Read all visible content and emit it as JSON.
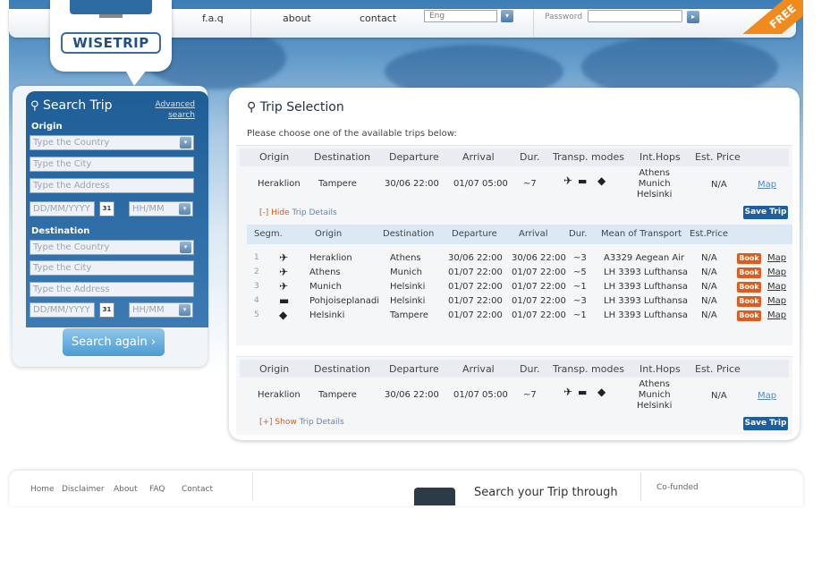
{
  "header": {
    "nav": [
      "f.a.q",
      "about",
      "contact"
    ],
    "language_value": "Eng",
    "password_label": "Password",
    "ribbon_text": "FREE",
    "logo_text": "WISETRIP"
  },
  "search": {
    "title": "Search Trip",
    "advanced_link": "Advanced search",
    "origin_label": "Origin",
    "destination_label": "Destination",
    "country_placeholder": "Type the Country",
    "city_placeholder": "Type the City",
    "address_placeholder": "Type the Address",
    "date_placeholder": "DD/MM/YYYY",
    "time_placeholder": "HH/MM",
    "calendar_day": "31",
    "search_again_label": "Search again ›"
  },
  "trips": {
    "title": "Trip Selection",
    "subtitle": "Please choose one of the available trips below:",
    "columns": [
      "Origin",
      "Destination",
      "Departure",
      "Arrival",
      "Dur.",
      "Transp. modes",
      "Int.Hops",
      "Est. Price"
    ],
    "list": [
      {
        "origin": "Heraklion",
        "destination": "Tampere",
        "departure": "30/06 22:00",
        "arrival": "01/07  05:00",
        "duration": "~7",
        "hops": [
          "Athens",
          "Munich",
          "Helsinki"
        ],
        "price": "N/A",
        "map": "Map",
        "save": "Save Trip",
        "toggle_action": "[-] Hide",
        "toggle_rest": "Trip Details"
      },
      {
        "origin": "Heraklion",
        "destination": "Tampere",
        "departure": "30/06 22:00",
        "arrival": "01/07  05:00",
        "duration": "~7",
        "hops": [
          "Athens",
          "Munich",
          "Helsinki"
        ],
        "price": "N/A",
        "map": "Map",
        "save": "Save Trip",
        "toggle_action": "[+] Show",
        "toggle_rest": "Trip Details"
      }
    ],
    "segment_columns": [
      "Segm.",
      "Origin",
      "Destination",
      "Departure",
      "Arrival",
      "Dur.",
      "Mean of Transport",
      "Est.Price"
    ],
    "segments": [
      {
        "n": "1",
        "icon": "plane",
        "origin": "Heraklion",
        "destination": "Athens",
        "departure": "30/06 22:00",
        "arrival": "30/06 22:00",
        "duration": "~3",
        "transport": "A3329 Aegean Air",
        "price": "N/A"
      },
      {
        "n": "2",
        "icon": "plane",
        "origin": "Athens",
        "destination": "Munich",
        "departure": "01/07 22:00",
        "arrival": "01/07 22:00",
        "duration": "~5",
        "transport": "LH 3393 Lufthansa",
        "price": "N/A"
      },
      {
        "n": "3",
        "icon": "plane",
        "origin": "Munich",
        "destination": "Helsinki",
        "departure": "01/07 22:00",
        "arrival": "01/07 22:00",
        "duration": "~1",
        "transport": "LH 3393 Lufthansa",
        "price": "N/A"
      },
      {
        "n": "4",
        "icon": "bus",
        "origin": "Pohjoiseplanadi",
        "destination": "Helsinki",
        "departure": "01/07 22:00",
        "arrival": "01/07 22:00",
        "duration": "~3",
        "transport": "LH 3393 Lufthansa",
        "price": "N/A"
      },
      {
        "n": "5",
        "icon": "car",
        "origin": "Helsinki",
        "destination": "Tampere",
        "departure": "01/07 22:00",
        "arrival": "01/07 22:00",
        "duration": "~1",
        "transport": "LH 3393 Lufthansa",
        "price": "N/A"
      }
    ],
    "book_label": "Book",
    "map_label": "Map"
  },
  "footer": {
    "links": [
      "Home",
      "Disclaimer",
      "About",
      "FAQ",
      "Contact"
    ],
    "promo": "Search your Trip through",
    "cofunded": "Co-funded"
  }
}
